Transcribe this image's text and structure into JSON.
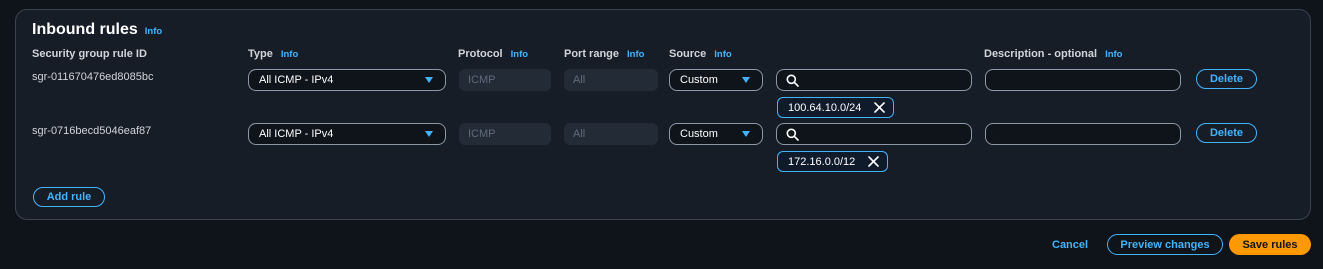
{
  "section": {
    "title": "Inbound rules",
    "info": "Info"
  },
  "columns": {
    "rule_id": "Security group rule ID",
    "type": "Type",
    "protocol": "Protocol",
    "port_range": "Port range",
    "source": "Source",
    "description": "Description - optional",
    "info": "Info"
  },
  "rules": [
    {
      "id": "sgr-011670476ed8085bc",
      "type": "All ICMP - IPv4",
      "protocol": "ICMP",
      "port_range": "All",
      "source": "Custom",
      "search_value": "",
      "cidr": "100.64.10.0/24",
      "description": "",
      "delete_label": "Delete"
    },
    {
      "id": "sgr-0716becd5046eaf87",
      "type": "All ICMP - IPv4",
      "protocol": "ICMP",
      "port_range": "All",
      "source": "Custom",
      "search_value": "",
      "cidr": "172.16.0.0/12",
      "description": "",
      "delete_label": "Delete"
    }
  ],
  "actions": {
    "add_rule": "Add rule",
    "cancel": "Cancel",
    "preview": "Preview changes",
    "save": "Save rules"
  },
  "colors": {
    "accent": "#42b4ff",
    "primary": "#ff9900",
    "background": "#0f141a",
    "panel": "#161d26"
  },
  "icons": {
    "search": "search-icon",
    "caret": "caret-down-icon",
    "remove": "close-icon"
  }
}
